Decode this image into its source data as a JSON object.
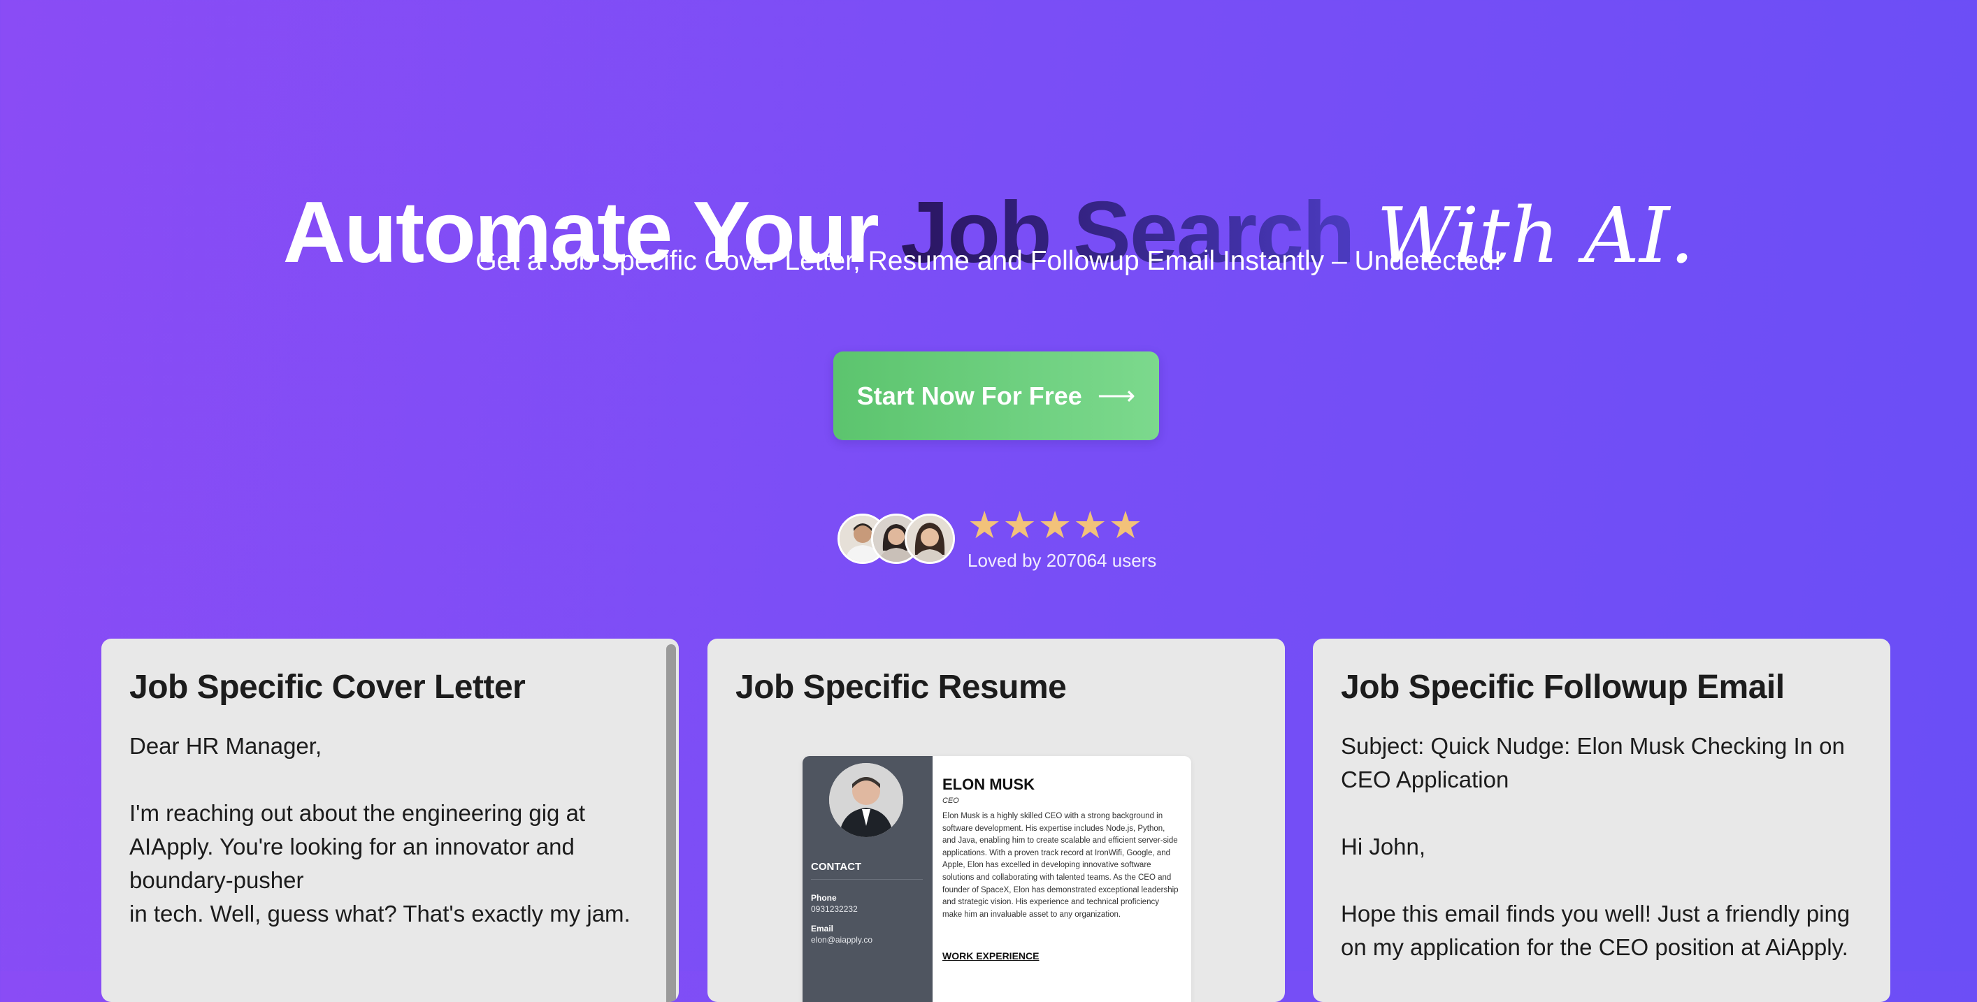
{
  "hero": {
    "title_part1": "Automate Your ",
    "title_part2": "Job Search",
    "title_part3": "With AI.",
    "subtitle": "Get a Job Specific Cover Letter, Resume and Followup Email Instantly – Undetected!"
  },
  "cta": {
    "label": "Start Now For Free",
    "icon": "arrow-right-icon",
    "color_start": "#5cc46e",
    "color_end": "#7cd98d"
  },
  "social_proof": {
    "stars": [
      "★",
      "★",
      "★",
      "★",
      "★"
    ],
    "rating": 5,
    "star_color": "#f2c27a",
    "loved_text": "Loved by 207064 users"
  },
  "cards": {
    "cover_letter": {
      "title": "Job Specific Cover Letter",
      "body": "Dear HR Manager,\n\nI'm reaching out about the engineering gig at AIApply. You're looking for an innovator and boundary-pusher\nin tech. Well, guess what? That's exactly my jam."
    },
    "resume": {
      "title": "Job Specific Resume",
      "name": "ELON MUSK",
      "role": "CEO",
      "summary": "Elon Musk is a highly skilled CEO with a strong background in software development. His expertise includes Node.js, Python, and Java, enabling him to create scalable and efficient server-side applications. With a proven track record at IronWifi, Google, and Apple, Elon has excelled in developing innovative software solutions and collaborating with talented teams. As the CEO and founder of SpaceX, Elon has demonstrated exceptional leadership and strategic vision. His experience and technical proficiency make him an invaluable asset to any organization.",
      "contact_heading": "CONTACT",
      "phone_label": "Phone",
      "phone": "0931232232",
      "email_label": "Email",
      "email": "elon@aiapply.co",
      "work_heading": "WORK EXPERIENCE"
    },
    "followup": {
      "title": "Job Specific Followup Email",
      "body": "Subject: Quick Nudge: Elon Musk Checking In on CEO Application\n\nHi John,\n\nHope this email finds you well! Just a friendly ping on my application for the CEO position at AiApply."
    }
  }
}
